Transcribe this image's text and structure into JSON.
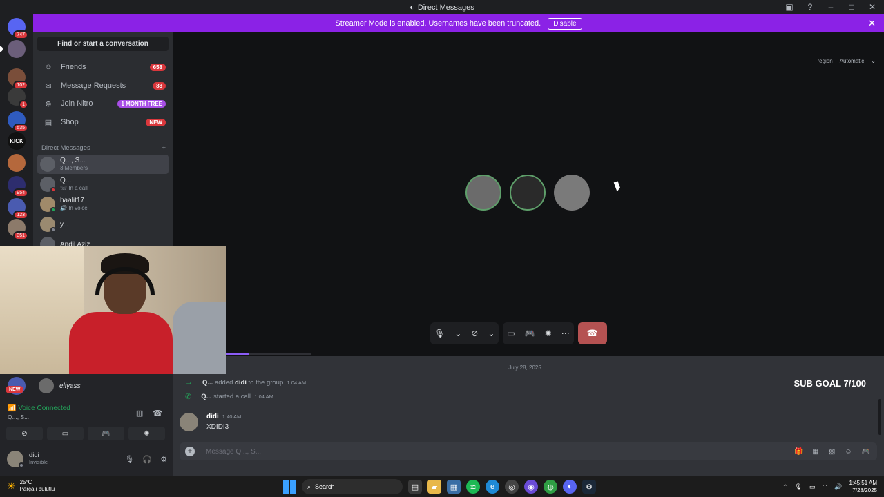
{
  "window": {
    "title": "Direct Messages"
  },
  "banner": {
    "text": "Streamer Mode is enabled. Usernames have been truncated.",
    "button": "Disable"
  },
  "servers": [
    {
      "badge": "747"
    },
    {
      "badge": ""
    },
    {
      "badge": "102"
    },
    {
      "badge": "1"
    },
    {
      "badge": "535"
    },
    {
      "label": "KICK",
      "badge": ""
    },
    {
      "badge": ""
    },
    {
      "badge": "954"
    },
    {
      "badge": "123"
    },
    {
      "badge": "351"
    }
  ],
  "sidebar": {
    "search": "Find or start a conversation",
    "nav": [
      {
        "label": "Friends",
        "pill": "658"
      },
      {
        "label": "Message Requests",
        "pill": "88"
      },
      {
        "label": "Join Nitro",
        "pill": "1 MONTH FREE"
      },
      {
        "label": "Shop",
        "pill": "NEW"
      }
    ],
    "dm_header": "Direct Messages",
    "dms": [
      {
        "name": "Q..., S...",
        "sub": "3 Members"
      },
      {
        "name": "Q...",
        "sub": "In a call"
      },
      {
        "name": "haalit17",
        "sub": "In voice"
      },
      {
        "name": "y...",
        "sub": ""
      },
      {
        "name": "Andil Aziz",
        "sub": ""
      }
    ]
  },
  "stage": {
    "region_label": "region",
    "region_value": "Automatic"
  },
  "chat": {
    "date": "July 28, 2025",
    "sub_goal": "SUB GOAL 7/100",
    "sys1": {
      "user": "Q...",
      "mid": "added",
      "target": "didi",
      "end": "to the group.",
      "time": "1:04 AM"
    },
    "sys2": {
      "user": "Q...",
      "text": "started a call.",
      "time": "1:04 AM"
    },
    "message": {
      "author": "didi",
      "time": "1:40 AM",
      "text": "XDIDI3"
    },
    "composer_placeholder": "Message Q..., S..."
  },
  "bottom": {
    "pending_user": "ellyass",
    "new_badge": "NEW",
    "voice_status": "Voice Connected",
    "voice_channel": "Q..., S...",
    "user_name": "didi",
    "user_status": "Invisible"
  },
  "taskbar": {
    "temp": "25°C",
    "weather": "Parçalı bulutlu",
    "search": "Search",
    "time": "1:45:51 AM",
    "date": "7/28/2025"
  }
}
